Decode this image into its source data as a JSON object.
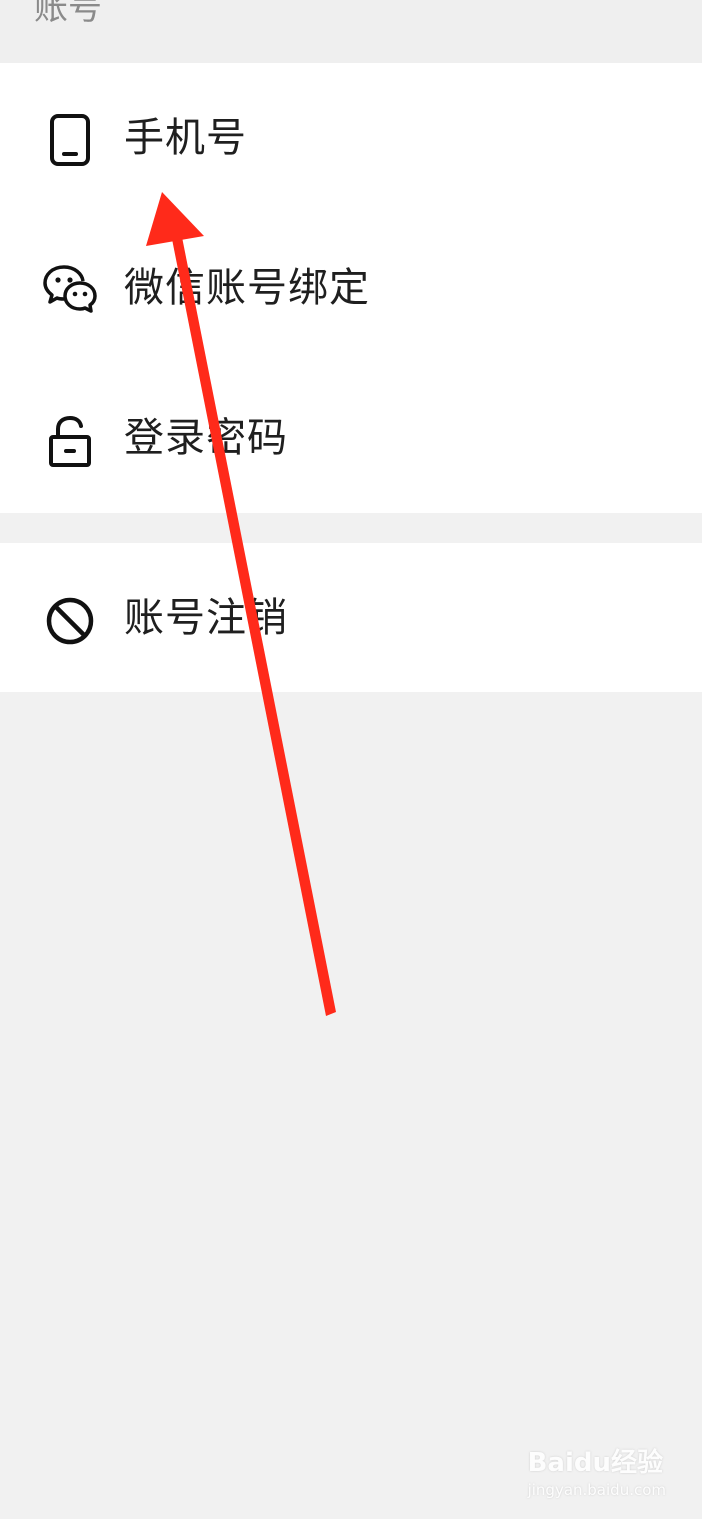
{
  "section": {
    "title": "账号"
  },
  "items": [
    {
      "label": "手机号",
      "icon": "phone-icon"
    },
    {
      "label": "微信账号绑定",
      "icon": "wechat-icon"
    },
    {
      "label": "登录密码",
      "icon": "unlock-icon"
    },
    {
      "label": "账号注销",
      "icon": "prohibited-icon"
    }
  ],
  "watermark": {
    "main": "Baidu经验",
    "sub": "jingyan.baidu.com"
  },
  "colors": {
    "arrow": "#ff2a1a",
    "background": "#f1f1f1",
    "card": "#ffffff"
  }
}
